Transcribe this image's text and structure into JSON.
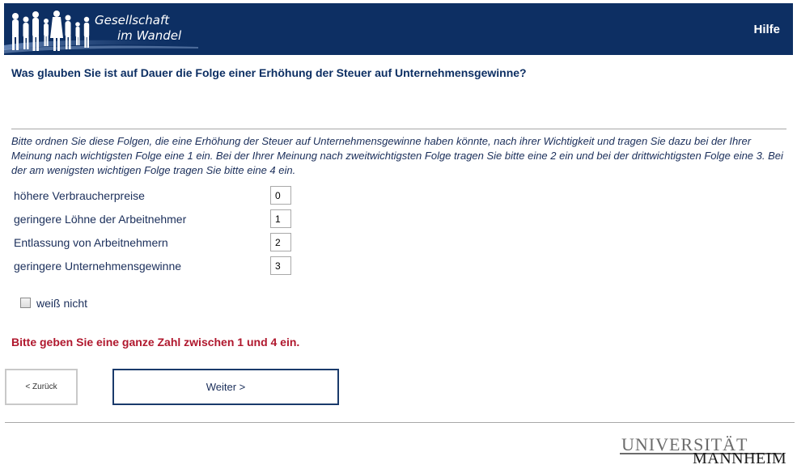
{
  "header": {
    "logo_line1": "Gesellschaft",
    "logo_line2": "im Wandel",
    "help_label": "Hilfe"
  },
  "survey": {
    "question": "Was glauben Sie ist auf Dauer die Folge einer Erhöhung der Steuer auf Unternehmensgewinne?",
    "instruction": "Bitte ordnen Sie diese Folgen, die eine Erhöhung der Steuer auf Unternehmensgewinne haben könnte, nach ihrer Wichtigkeit und tragen Sie dazu bei der Ihrer Meinung nach wichtigsten Folge eine 1 ein. Bei der Ihrer Meinung nach zweitwichtigsten Folge tragen Sie bitte eine 2 ein und bei der drittwichtigsten Folge eine 3. Bei der am wenigsten wichtigen Folge tragen Sie bitte eine 4 ein.",
    "items": [
      {
        "label": "höhere Verbraucherpreise",
        "value": "0"
      },
      {
        "label": "geringere Löhne der Arbeitnehmer",
        "value": "1"
      },
      {
        "label": "Entlassung von Arbeitnehmern",
        "value": "2"
      },
      {
        "label": "geringere Unternehmensgewinne",
        "value": "3"
      }
    ],
    "dont_know_label": "weiß nicht",
    "error_message": "Bitte geben Sie eine ganze Zahl zwischen 1 und 4 ein."
  },
  "navigation": {
    "back_label": "< Zurück",
    "next_label": "Weiter >"
  },
  "footer": {
    "uni_line1": "UNIVERSITÄT",
    "uni_line2": "MANNHEIM"
  },
  "colors": {
    "header_bg": "#0d2f63",
    "text": "#1a2e5a",
    "error": "#b0182e"
  }
}
